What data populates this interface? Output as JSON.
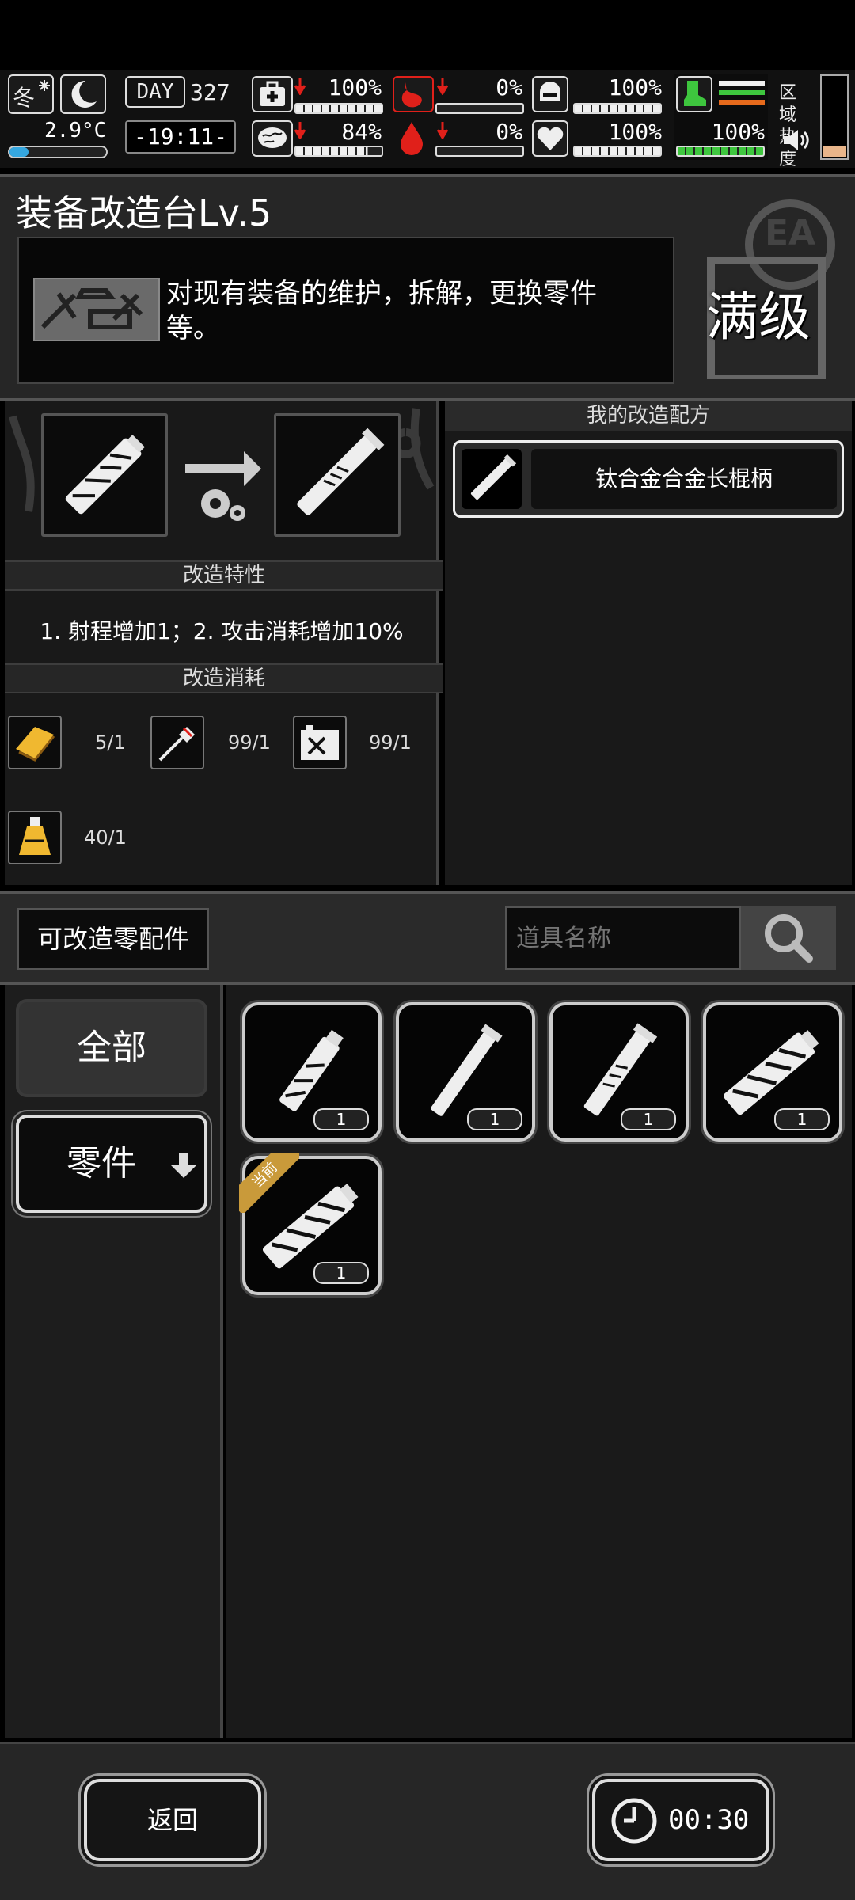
{
  "hud": {
    "season": "冬",
    "temperature": "2.9°C",
    "day_label": "DAY",
    "day_number": "327",
    "time": "-19:11-",
    "stats": [
      {
        "name": "health",
        "value": "100%"
      },
      {
        "name": "hunger",
        "value": "0%"
      },
      {
        "name": "armor",
        "value": "100%"
      },
      {
        "name": "sanity",
        "value": "84%"
      },
      {
        "name": "bleeding",
        "value": "0%"
      },
      {
        "name": "heart",
        "value": "100%"
      }
    ],
    "stamina": "100%",
    "zone_heat_label": "区域热度",
    "colors": {
      "stamina": "#3ec63e",
      "danger": "#e0201a",
      "heat_fill": "#e8b58a"
    }
  },
  "station": {
    "title": "装备改造台Lv.5",
    "description": "对现有装备的维护，拆解，更换零件等。",
    "badge_text": "满级",
    "badge_letters": "EA"
  },
  "mod": {
    "traits_header": "改造特性",
    "traits_text": "1. 射程增加1；2. 攻击消耗增加10%",
    "cost_header": "改造消耗",
    "costs": [
      {
        "icon": "gold-bar-icon",
        "value": "5/1"
      },
      {
        "icon": "screwdriver-icon",
        "value": "99/1"
      },
      {
        "icon": "battery-icon",
        "value": "99/1"
      },
      {
        "icon": "oil-flask-icon",
        "value": "40/1"
      }
    ]
  },
  "recipes": {
    "header": "我的改造配方",
    "items": [
      {
        "label": "钛合金合金长棍柄"
      }
    ]
  },
  "parts": {
    "modifiable_label": "可改造零配件",
    "search_placeholder": "道具名称",
    "tabs": [
      {
        "label": "全部"
      },
      {
        "label": "零件"
      }
    ],
    "items": [
      {
        "qty": "1",
        "tag": ""
      },
      {
        "qty": "1",
        "tag": ""
      },
      {
        "qty": "1",
        "tag": ""
      },
      {
        "qty": "1",
        "tag": ""
      },
      {
        "qty": "1",
        "tag": "当前"
      }
    ]
  },
  "footer": {
    "back_label": "返回",
    "timer": "00:30"
  }
}
